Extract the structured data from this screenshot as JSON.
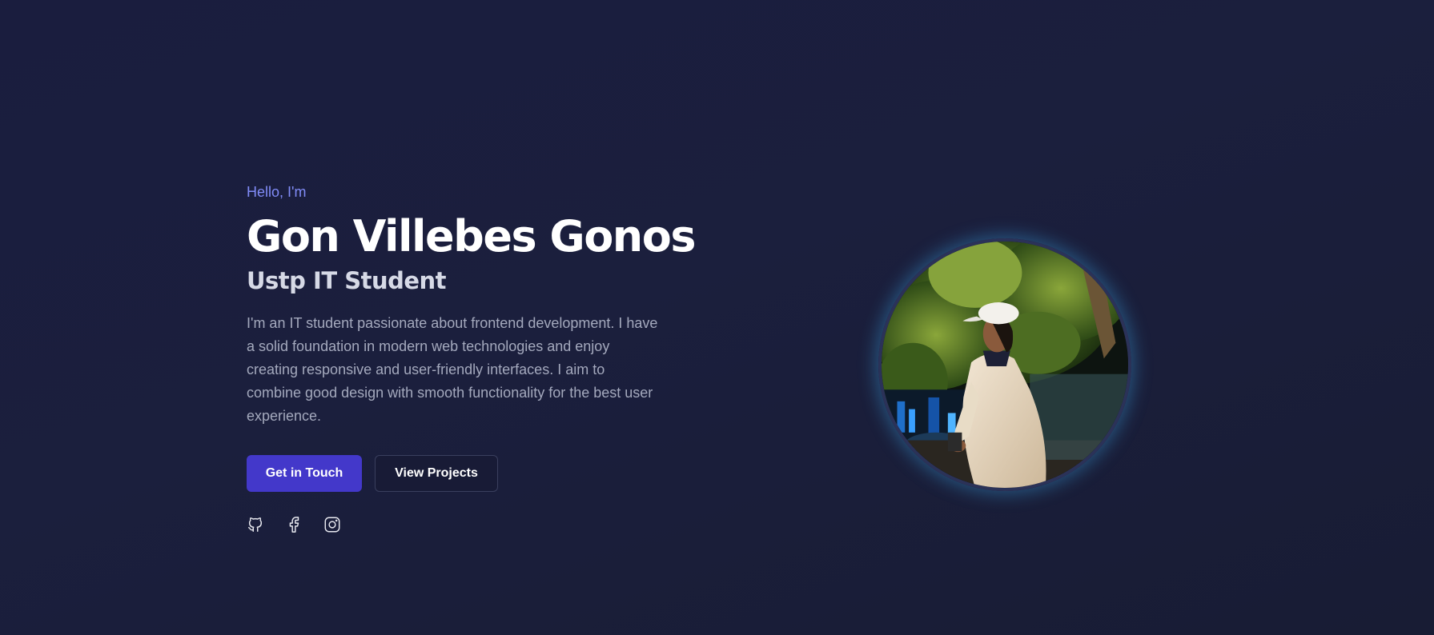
{
  "hero": {
    "greeting": "Hello, I'm",
    "name": "Gon Villebes Gonos",
    "role": "Ustp IT Student",
    "bio": "I'm an IT student passionate about frontend development. I have a solid foundation in modern web technologies and enjoy creating responsive and user-friendly interfaces. I aim to combine good design with smooth functionality for the best user experience."
  },
  "actions": {
    "primary_label": "Get in Touch",
    "secondary_label": "View Projects"
  },
  "socials": [
    {
      "icon": "github-icon"
    },
    {
      "icon": "facebook-icon"
    },
    {
      "icon": "instagram-icon"
    }
  ],
  "colors": {
    "accent": "#818cf8",
    "primary_button": "#4338ca",
    "background": "#1a1d3e"
  }
}
